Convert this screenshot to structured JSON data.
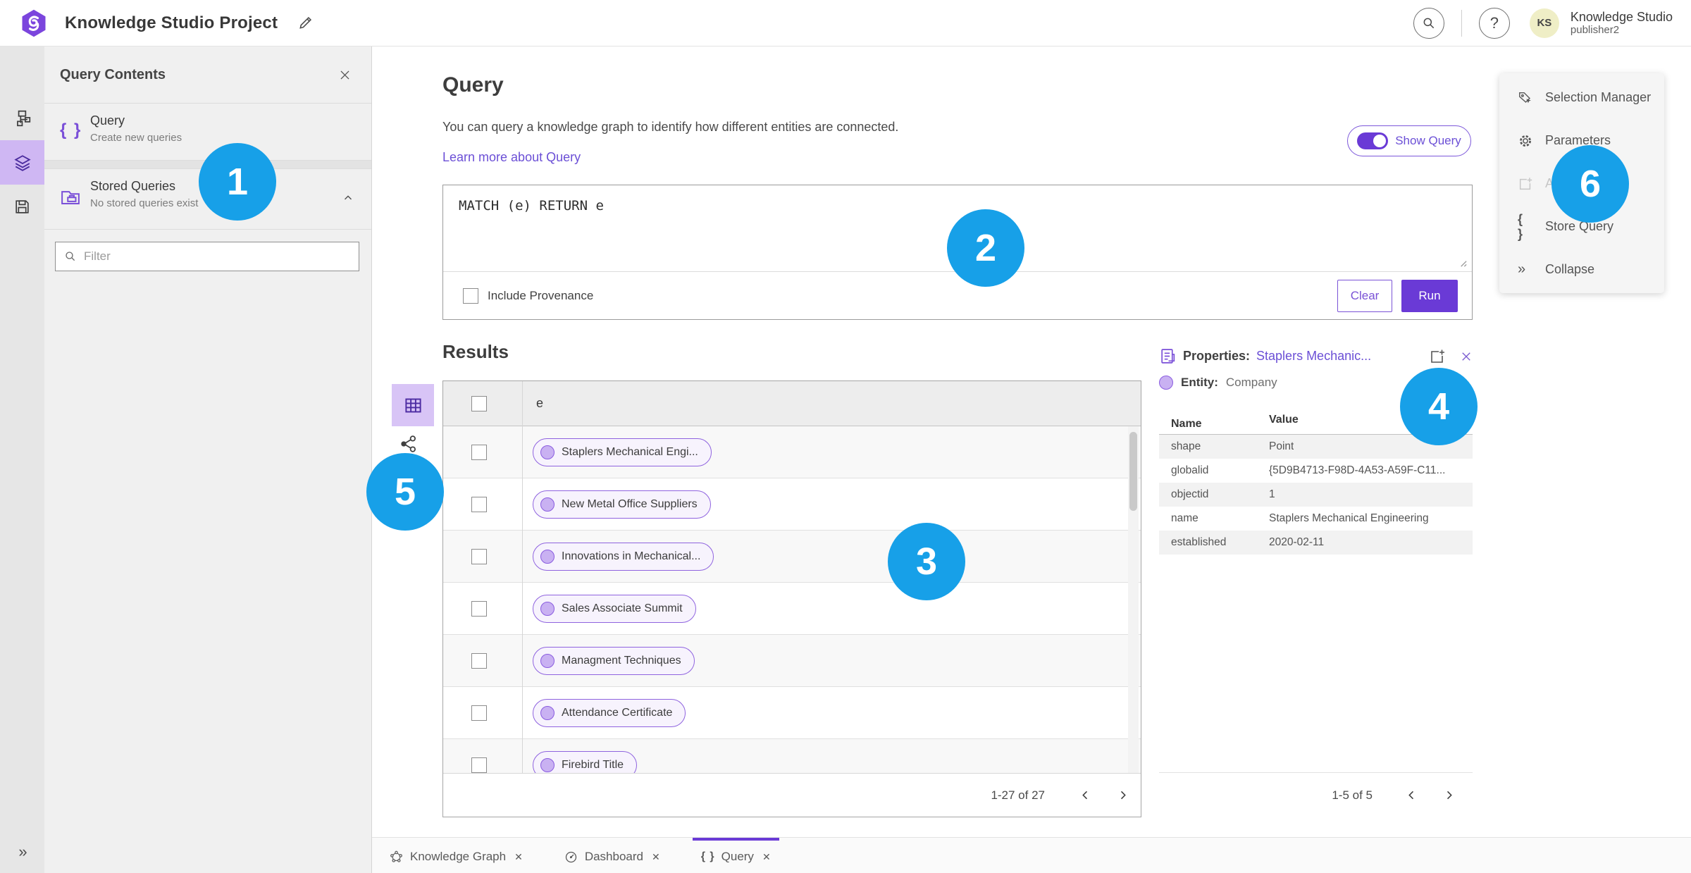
{
  "header": {
    "app_title": "Knowledge Studio Project",
    "user_name": "Knowledge Studio",
    "user_role": "publisher2",
    "avatar_initials": "KS",
    "help_glyph": "?"
  },
  "left_rail": {
    "items": [
      {
        "icon": "data-model-icon",
        "active": false
      },
      {
        "icon": "layers-icon",
        "active": true
      },
      {
        "icon": "save-icon",
        "active": false
      }
    ],
    "expand_glyph": "»"
  },
  "contents_panel": {
    "title": "Query Contents",
    "query_item": {
      "label": "Query",
      "description": "Create new queries",
      "icon": "braces-icon",
      "braces": "{ }"
    },
    "stored_queries": {
      "label": "Stored Queries",
      "description": "No stored queries exist",
      "icon": "stored-queries-folder-icon"
    },
    "filter_placeholder": "Filter"
  },
  "query_section": {
    "title": "Query",
    "description": "You can query a knowledge graph to identify how different entities are connected.",
    "learn_more": "Learn more about Query",
    "show_query_label": "Show Query",
    "show_query_on": true,
    "query_text": "MATCH (e) RETURN e",
    "include_provenance_label": "Include Provenance",
    "include_provenance_checked": false,
    "clear_label": "Clear",
    "run_label": "Run"
  },
  "results": {
    "title": "Results",
    "column_header": "e",
    "rows": [
      "Staplers Mechanical Engi...",
      "New Metal Office Suppliers",
      "Innovations in Mechanical...",
      "Sales Associate Summit",
      "Managment Techniques",
      "Attendance Certificate",
      "Firebird Title"
    ],
    "pagination": "1-27 of 27"
  },
  "properties": {
    "title_label": "Properties:",
    "title_link": "Staplers Mechanic...",
    "entity_label": "Entity:",
    "entity_value": "Company",
    "columns": {
      "name": "Name",
      "value": "Value"
    },
    "rows": [
      {
        "name": "shape",
        "value": "Point"
      },
      {
        "name": "globalid",
        "value": "{5D9B4713-F98D-4A53-A59F-C11..."
      },
      {
        "name": "objectid",
        "value": "1"
      },
      {
        "name": "name",
        "value": "Staplers Mechanical Engineering"
      },
      {
        "name": "established",
        "value": "2020-02-11"
      }
    ],
    "pagination": "1-5 of 5"
  },
  "side_menu": {
    "items": [
      {
        "label": "Selection Manager",
        "icon": "selection-manager-icon",
        "disabled": false
      },
      {
        "label": "Parameters",
        "icon": "gear-icon",
        "disabled": false
      },
      {
        "label": "Add To Map",
        "icon": "add-to-map-icon",
        "disabled": true
      },
      {
        "label": "Store Query",
        "icon": "braces-icon",
        "braces": "{ }",
        "disabled": false
      },
      {
        "label": "Collapse",
        "icon": "collapse-icon",
        "glyph": "»",
        "disabled": false
      }
    ]
  },
  "tabs": {
    "items": [
      {
        "label": "Knowledge Graph",
        "icon": "knowledge-graph-icon",
        "active": false
      },
      {
        "label": "Dashboard",
        "icon": "dashboard-icon",
        "active": false
      },
      {
        "label": "Query",
        "icon": "braces-icon",
        "braces": "{ }",
        "active": true
      }
    ],
    "close_glyph": "✕"
  },
  "annotations": {
    "labels": [
      "1",
      "2",
      "3",
      "4",
      "5",
      "6"
    ]
  },
  "colors": {
    "accent_purple": "#6a3ad6",
    "accent_purple_light": "#d8c4f6",
    "rail_active_bg": "#cfb7f3",
    "pill_bg": "#f7f3fd",
    "pill_border": "#8f63df",
    "annotation_blue": "#17a0e8",
    "avatar_bg": "#efeec6",
    "link_purple": "#6b4fd6",
    "panel_bg": "#f0f0f0"
  }
}
